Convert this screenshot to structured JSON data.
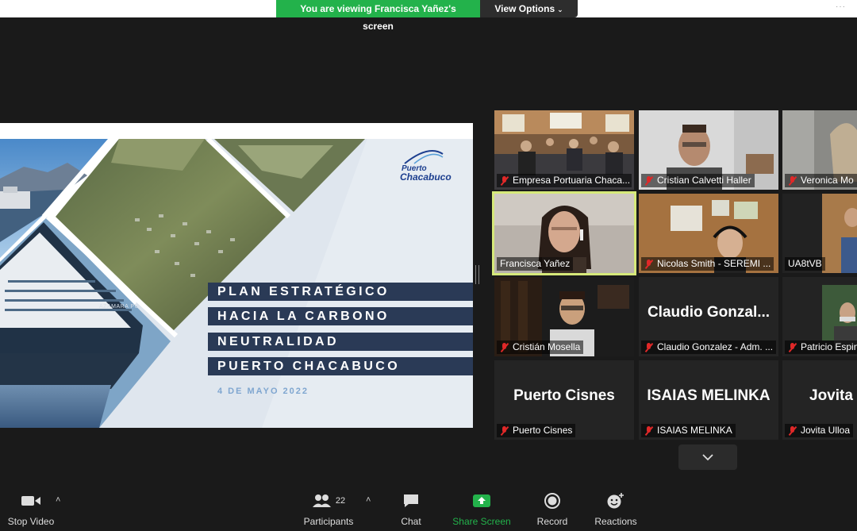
{
  "banner": {
    "viewing_text": "You are viewing Francisca Yañez's screen",
    "view_options_label": "View Options",
    "more_glyph": "···"
  },
  "slide": {
    "logo_line1": "Puerto",
    "logo_line2": "Chacabuco",
    "title_lines": [
      "PLAN ESTRATÉGICO",
      "HACIA LA CARBONO",
      "NEUTRALIDAD",
      "PUERTO CHACABUCO"
    ],
    "date": "4 DE MAYO 2022",
    "ship_name": "AZAMARA PU"
  },
  "participants": [
    {
      "name": "Empresa Portuaria Chaca...",
      "muted": true,
      "video": true
    },
    {
      "name": "Cristian Calvetti Haller",
      "muted": true,
      "video": true
    },
    {
      "name": "Veronica Mo",
      "muted": true,
      "video": true
    },
    {
      "name": "Francisca Yañez",
      "muted": false,
      "video": true,
      "active_speaker": true
    },
    {
      "name": "Nicolas Smith - SEREMI ...",
      "muted": true,
      "video": true
    },
    {
      "name": "UA8tVB",
      "muted": false,
      "video": true
    },
    {
      "name": "Cristián Mosella",
      "muted": true,
      "video": true
    },
    {
      "name": "Claudio Gonzalez - Adm. ...",
      "muted": true,
      "video": false,
      "display_name": "Claudio  Gonzal..."
    },
    {
      "name": "Patricio Espin",
      "muted": true,
      "video": true
    },
    {
      "name": "Puerto Cisnes",
      "muted": true,
      "video": false,
      "display_name": "Puerto Cisnes"
    },
    {
      "name": "ISAIAS MELINKA",
      "muted": true,
      "video": false,
      "display_name": "ISAIAS MELINKA"
    },
    {
      "name": "Jovita Ulloa",
      "muted": true,
      "video": false,
      "display_name": "Jovita"
    }
  ],
  "toolbar": {
    "stop_video": "Stop Video",
    "participants_label": "Participants",
    "participants_count": "22",
    "chat": "Chat",
    "share_screen": "Share Screen",
    "record": "Record",
    "reactions": "Reactions"
  },
  "colors": {
    "accent_green": "#23b24b",
    "active_border": "#d6e97a",
    "slide_navy": "#2a3a56",
    "muted_red": "#e02828"
  },
  "icons": [
    "video-camera-icon",
    "participants-icon",
    "chat-icon",
    "share-screen-icon",
    "record-icon",
    "reactions-icon",
    "mic-muted-icon",
    "chevron-down-icon",
    "chevron-up-icon"
  ]
}
